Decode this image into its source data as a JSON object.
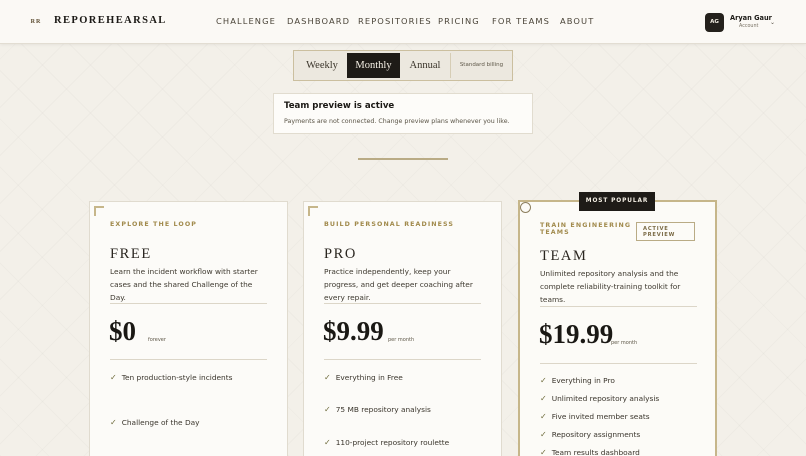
{
  "header": {
    "logo_mark": "RR",
    "logo_text": "REPOREHEARSAL",
    "nav": [
      "CHALLENGE",
      "DASHBOARD",
      "REPOSITORIES",
      "PRICING",
      "FOR TEAMS",
      "ABOUT"
    ],
    "user": {
      "initials": "AG",
      "name": "Aryan Gaur",
      "role": "Account"
    }
  },
  "billing": {
    "options": [
      "Weekly",
      "Monthly",
      "Annual"
    ],
    "selected": "Monthly",
    "note": "Standard billing"
  },
  "notice": {
    "title": "Team preview is active",
    "body": "Payments are not connected. Change preview plans whenever you like."
  },
  "plans": [
    {
      "eyebrow": "EXPLORE THE LOOP",
      "name": "FREE",
      "description": "Learn the incident workflow with starter cases and the shared Challenge of the Day.",
      "price": "$0",
      "unit": "forever",
      "features": [
        "Ten production-style incidents",
        "Challenge of the Day"
      ]
    },
    {
      "eyebrow": "BUILD PERSONAL READINESS",
      "name": "PRO",
      "description": "Practice independently, keep your progress, and get deeper coaching after every repair.",
      "price": "$9.99",
      "unit": "per month",
      "features": [
        "Everything in Free",
        "75 MB repository analysis",
        "110-project repository roulette"
      ]
    },
    {
      "eyebrow": "TRAIN ENGINEERING TEAMS",
      "badge": "ACTIVE PREVIEW",
      "popular": "MOST POPULAR",
      "name": "TEAM",
      "description": "Unlimited repository analysis and the complete reliability-training toolkit for teams.",
      "price": "$19.99",
      "unit": "per month",
      "features": [
        "Everything in Pro",
        "Unlimited repository analysis",
        "Five invited member seats",
        "Repository assignments",
        "Team results dashboard"
      ]
    }
  ]
}
